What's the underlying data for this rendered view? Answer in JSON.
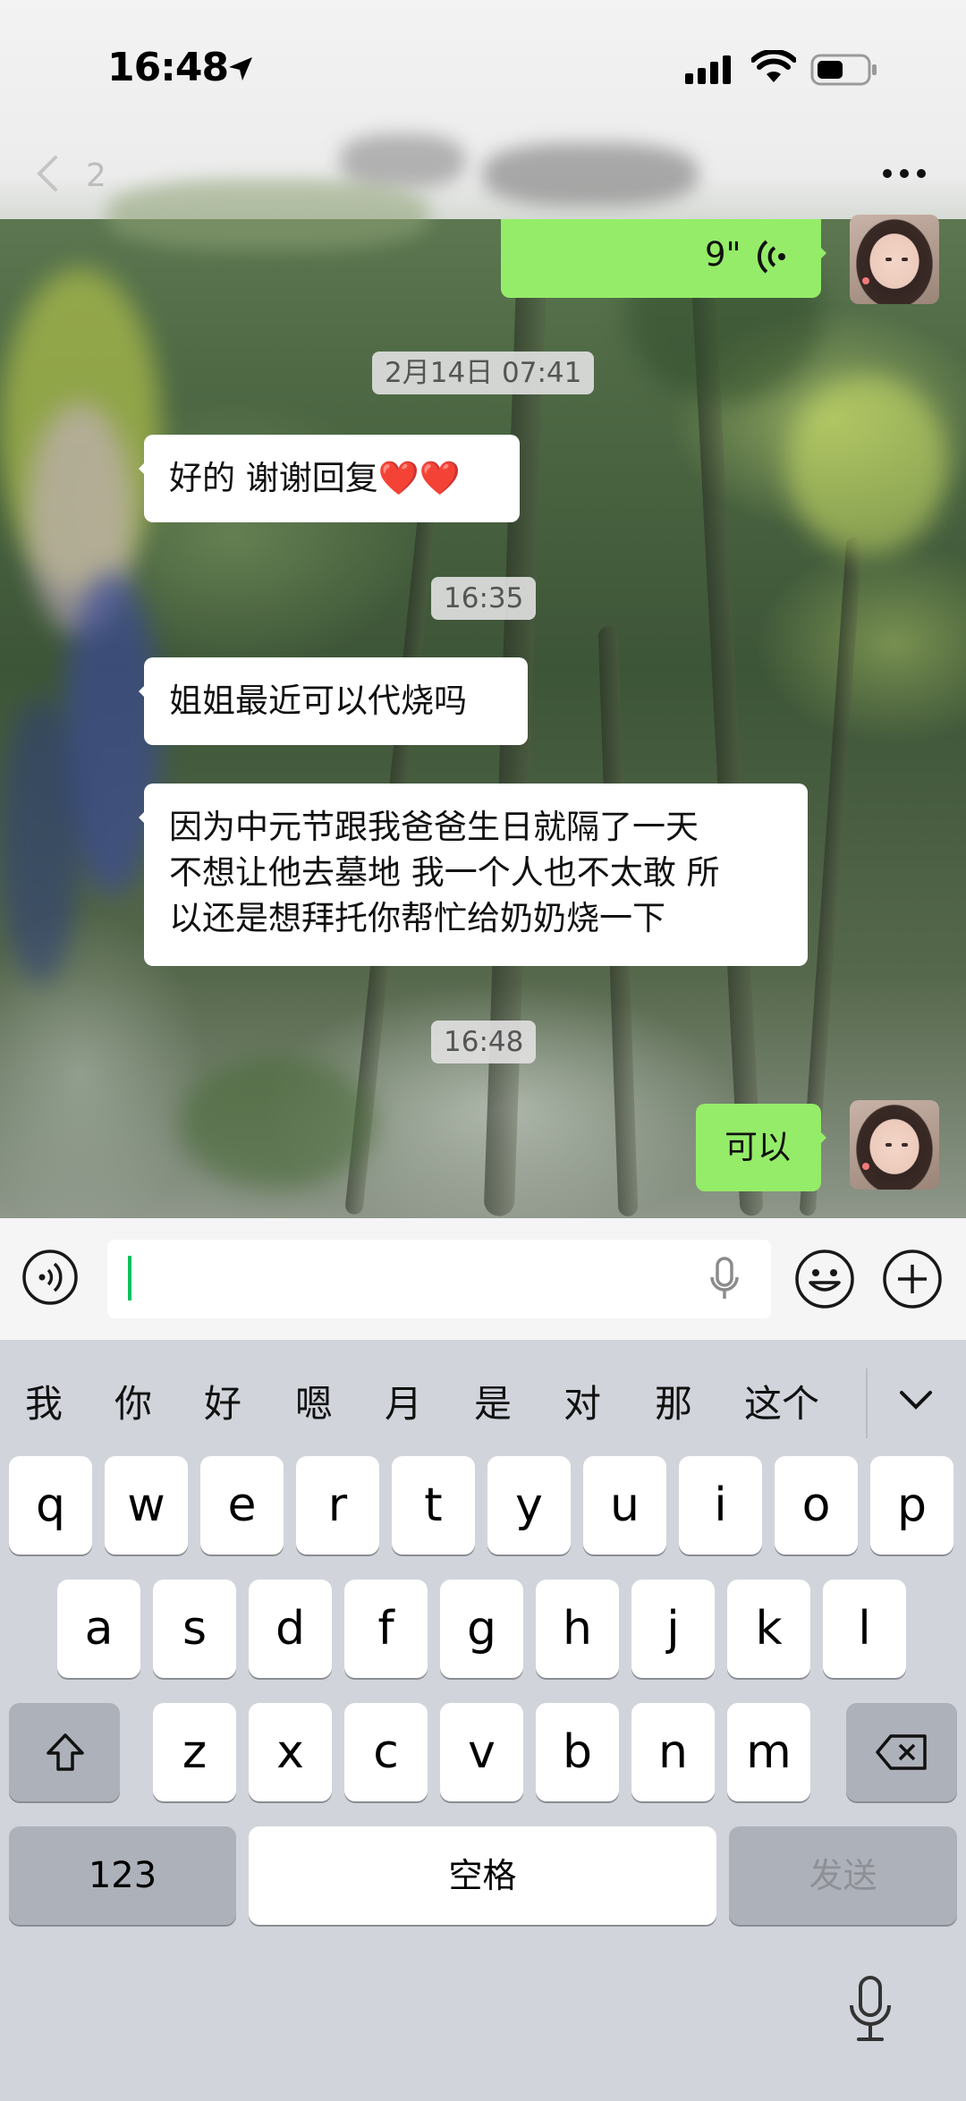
{
  "status_bar": {
    "time": "16:48"
  },
  "header": {
    "back_label": "2",
    "title": "",
    "more_icon": "more-icon"
  },
  "messages": {
    "voice": {
      "duration": "9\""
    },
    "ts1": "2月14日 07:41",
    "msg1": "好的 谢谢回复❤️❤️",
    "ts2": "16:35",
    "msg2": "姐姐最近可以代烧吗",
    "msg3_line1": "因为中元节跟我爸爸生日就隔了一天",
    "msg3_line2": "不想让他去墓地 我一个人也不太敢 所",
    "msg3_line3": "以还是想拜托你帮忙给奶奶烧一下",
    "ts3": "16:48",
    "msg4": "可以"
  },
  "input_bar": {
    "value": ""
  },
  "keyboard": {
    "candidates": [
      "我",
      "你",
      "好",
      "嗯",
      "月",
      "是",
      "对",
      "那",
      "这个"
    ],
    "row1": [
      "q",
      "w",
      "e",
      "r",
      "t",
      "y",
      "u",
      "i",
      "o",
      "p"
    ],
    "row2": [
      "a",
      "s",
      "d",
      "f",
      "g",
      "h",
      "j",
      "k",
      "l"
    ],
    "row3": [
      "z",
      "x",
      "c",
      "v",
      "b",
      "n",
      "m"
    ],
    "numbers_label": "123",
    "space_label": "空格",
    "send_label": "发送"
  },
  "colors": {
    "outgoing_bubble": "#95ec69",
    "incoming_bubble": "#ffffff",
    "cursor": "#07c160",
    "keyboard_bg": "#d1d4db"
  }
}
